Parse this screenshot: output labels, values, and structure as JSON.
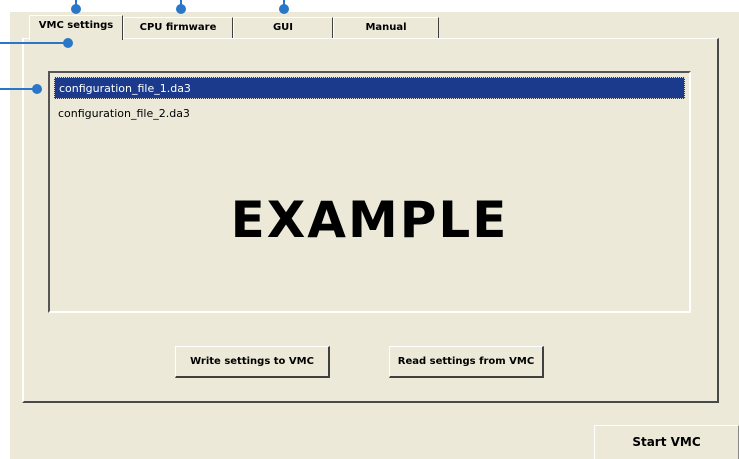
{
  "tabs": [
    {
      "label": "VMC settings",
      "active": true
    },
    {
      "label": "CPU firmware",
      "active": false
    },
    {
      "label": "GUI",
      "active": false
    },
    {
      "label": "Manual",
      "active": false
    }
  ],
  "file_list": {
    "items": [
      {
        "label": "configuration_file_1.da3",
        "selected": true
      },
      {
        "label": "configuration_file_2.da3",
        "selected": false
      }
    ]
  },
  "watermark": "EXAMPLE",
  "buttons": {
    "write_settings": "Write settings to VMC",
    "read_settings": "Read settings from VMC",
    "start_vmc": "Start VMC"
  },
  "colors": {
    "window_bg": "#ece9d8",
    "selection_bg": "#1c3a8c",
    "callout": "#2a76c9"
  }
}
